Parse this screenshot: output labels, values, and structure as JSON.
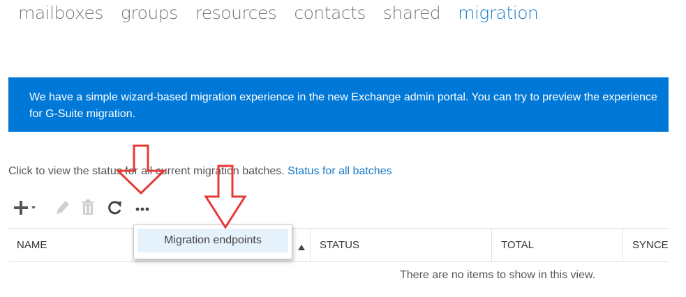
{
  "nav": {
    "tabs": [
      {
        "label": "mailboxes",
        "active": false
      },
      {
        "label": "groups",
        "active": false
      },
      {
        "label": "resources",
        "active": false
      },
      {
        "label": "contacts",
        "active": false
      },
      {
        "label": "shared",
        "active": false
      },
      {
        "label": "migration",
        "active": true
      }
    ]
  },
  "banner": {
    "text": "We have a simple wizard-based migration experience in the new Exchange admin portal. You can try to preview the experience for G-Suite migration."
  },
  "status": {
    "prefix": "Click to view the status for all current migration batches.",
    "link": "Status for all batches"
  },
  "toolbar": {
    "icons": [
      "add-icon",
      "edit-icon",
      "delete-icon",
      "refresh-icon",
      "more-icon"
    ]
  },
  "table": {
    "columns": [
      "NAME",
      "STATUS",
      "TOTAL",
      "SYNCED"
    ],
    "empty_message": "There are no items to show in this view."
  },
  "dropdown": {
    "item": "Migration endpoints"
  },
  "colors": {
    "accent": "#1479c6",
    "banner_bg": "#0078d7",
    "annotation_arrow": "#e53935",
    "menu_highlight": "#e5f1fb"
  }
}
